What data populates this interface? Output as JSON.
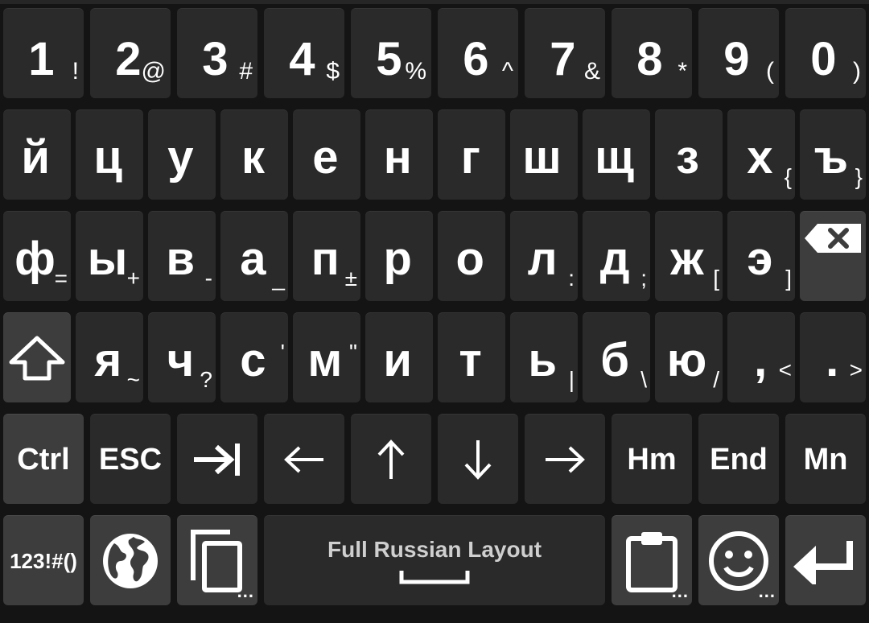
{
  "keyboard": {
    "number_row": [
      {
        "main": "1",
        "sub": "!"
      },
      {
        "main": "2",
        "sub": "@"
      },
      {
        "main": "3",
        "sub": "#"
      },
      {
        "main": "4",
        "sub": "$"
      },
      {
        "main": "5",
        "sub": "%"
      },
      {
        "main": "6",
        "sub": "^"
      },
      {
        "main": "7",
        "sub": "&"
      },
      {
        "main": "8",
        "sub": "*"
      },
      {
        "main": "9",
        "sub": "("
      },
      {
        "main": "0",
        "sub": ")"
      }
    ],
    "row1": [
      {
        "main": "й",
        "sub": ""
      },
      {
        "main": "ц",
        "sub": ""
      },
      {
        "main": "у",
        "sub": ""
      },
      {
        "main": "к",
        "sub": ""
      },
      {
        "main": "е",
        "sub": ""
      },
      {
        "main": "н",
        "sub": ""
      },
      {
        "main": "г",
        "sub": ""
      },
      {
        "main": "ш",
        "sub": ""
      },
      {
        "main": "щ",
        "sub": ""
      },
      {
        "main": "з",
        "sub": ""
      },
      {
        "main": "х",
        "sub": "{"
      },
      {
        "main": "ъ",
        "sub": "}"
      }
    ],
    "row2": [
      {
        "main": "ф",
        "sub": "="
      },
      {
        "main": "ы",
        "sub": "+"
      },
      {
        "main": "в",
        "sub": "-"
      },
      {
        "main": "а",
        "sub": "_"
      },
      {
        "main": "п",
        "sub": "±"
      },
      {
        "main": "р",
        "sub": ""
      },
      {
        "main": "о",
        "sub": ""
      },
      {
        "main": "л",
        "sub": ":"
      },
      {
        "main": "д",
        "sub": ";"
      },
      {
        "main": "ж",
        "sub": "["
      },
      {
        "main": "э",
        "sub": "]"
      }
    ],
    "row3": [
      {
        "main": "я",
        "sub": "~"
      },
      {
        "main": "ч",
        "sub": "?"
      },
      {
        "main": "с",
        "sub": "'"
      },
      {
        "main": "м",
        "sub": "\""
      },
      {
        "main": "и",
        "sub": ""
      },
      {
        "main": "т",
        "sub": ""
      },
      {
        "main": "ь",
        "sub": "|"
      },
      {
        "main": "б",
        "sub": "\\"
      },
      {
        "main": "ю",
        "sub": "/"
      },
      {
        "main": ",",
        "sub": "<"
      },
      {
        "main": ".",
        "sub": ">"
      }
    ],
    "nav_row": {
      "ctrl": "Ctrl",
      "esc": "ESC",
      "tab": "⇥",
      "left": "←",
      "up": "↑",
      "down": "↓",
      "right": "→",
      "home": "Hm",
      "end": "End",
      "menu": "Mn"
    },
    "bottom_row": {
      "symbols": "123!#()",
      "space_label": "Full Russian Layout",
      "more_dots": "..."
    },
    "icons": {
      "shift": "shift-arrow-icon",
      "backspace": "backspace-icon",
      "globe": "globe-icon",
      "copy": "copy-icon",
      "clipboard": "clipboard-icon",
      "emoji": "smiley-icon",
      "enter": "enter-icon"
    },
    "colors": {
      "background": "#141414",
      "key": "#2a2a2a",
      "modifier_key": "#3d3d3d",
      "text": "#ffffff",
      "space_label": "#cfcfcf"
    }
  }
}
